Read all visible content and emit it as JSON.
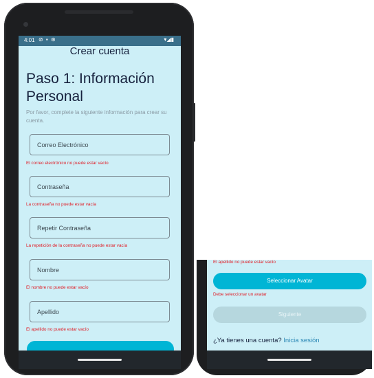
{
  "status_bar": {
    "time": "4:01",
    "icons": "⊘ ▪ ⊛",
    "network": "▾◢▮"
  },
  "app_bar": {
    "title": "Crear cuenta"
  },
  "form": {
    "heading": "Paso 1: Información Personal",
    "subtitle": "Por favor, complete la siguiente información para crear su cuenta.",
    "fields": [
      {
        "placeholder": "Correo Electrónico",
        "error": "El correo electrónico no puede estar vacío"
      },
      {
        "placeholder": "Contraseña",
        "error": "La contraseña no puede estar vacía"
      },
      {
        "placeholder": "Repetir Contraseña",
        "error": "La repetición de la contraseña no puede estar vacía"
      },
      {
        "placeholder": "Nombre",
        "error": "El nombre no puede estar vacío"
      },
      {
        "placeholder": "Apellido",
        "error": "El apellido no puede estar vacío"
      }
    ]
  },
  "bottom_panel": {
    "apellido_error": "El apellido no puede estar vacío",
    "avatar_button": "Seleccionar Avatar",
    "avatar_error": "Debe seleccionar un avatar",
    "next_button": "Siguiente",
    "login_prompt": "¿Ya tienes una cuenta?",
    "login_link": "Inicia sesión"
  },
  "colors": {
    "background": "#cdeff7",
    "accent": "#00b5d5",
    "error": "#e11b24",
    "disabled": "#b6d7de",
    "link": "#2a87b5"
  }
}
